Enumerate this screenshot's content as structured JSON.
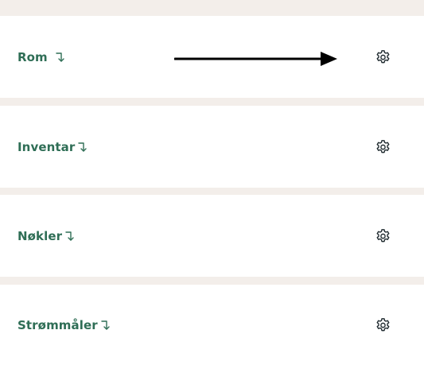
{
  "sections": [
    {
      "label": "Rom",
      "link_icon": "arrow-return-down-icon",
      "settings_icon": "gear-icon"
    },
    {
      "label": "Inventar",
      "link_icon": "arrow-return-down-icon",
      "settings_icon": "gear-icon"
    },
    {
      "label": "Nøkler",
      "link_icon": "arrow-return-down-icon",
      "settings_icon": "gear-icon"
    },
    {
      "label": "Strømmåler",
      "link_icon": "arrow-return-down-icon",
      "settings_icon": "gear-icon"
    }
  ],
  "colors": {
    "page_background": "#f3eeea",
    "row_background": "#ffffff",
    "accent_green": "#2f6e56",
    "icon_dark": "#1f2a2f",
    "annotation": "#000000"
  },
  "annotation": {
    "icon": "arrow-right-icon"
  }
}
